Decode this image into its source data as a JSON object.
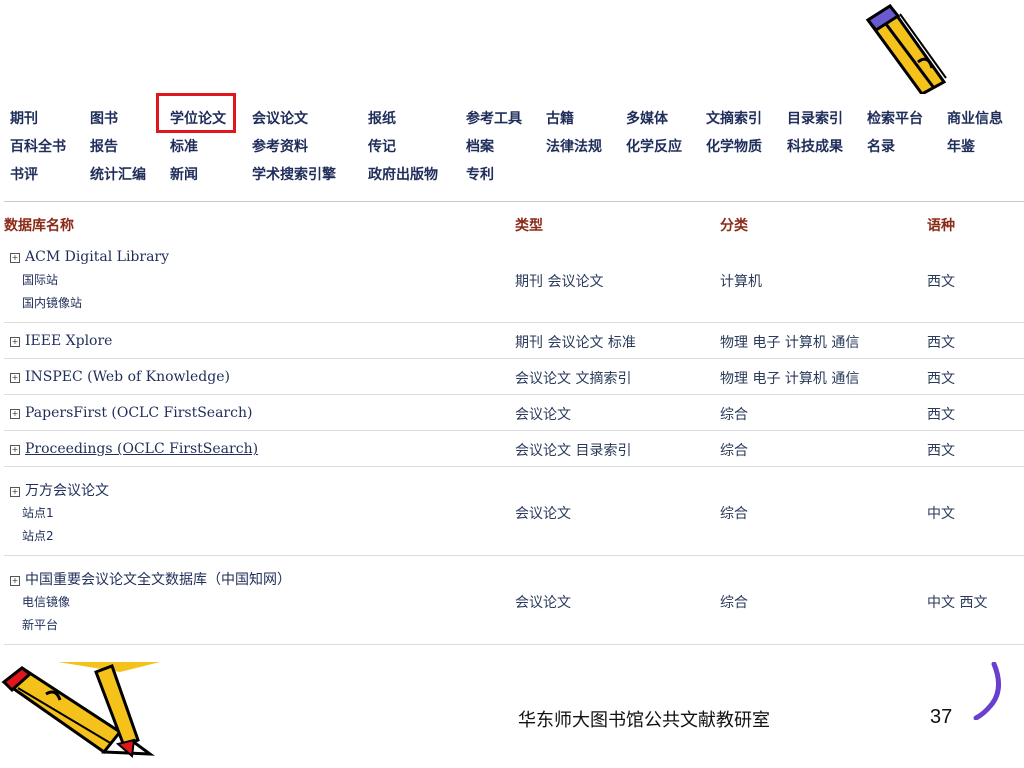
{
  "nav": {
    "row1": [
      "期刊",
      "图书",
      "学位论文",
      "会议论文",
      "报纸",
      "参考工具",
      "古籍",
      "多媒体",
      "文摘索引",
      "目录索引",
      "检索平台",
      "商业信息"
    ],
    "row2": [
      "百科全书",
      "报告",
      "标准",
      "参考资料",
      "传记",
      "档案",
      "法律法规",
      "化学反应",
      "化学物质",
      "科技成果",
      "名录",
      "年鉴"
    ],
    "row3": [
      "书评",
      "统计汇编",
      "新闻",
      "学术搜索引擎",
      "政府出版物",
      "专利"
    ],
    "highlighted": "学位论文",
    "highlight_color": "#e0161c"
  },
  "table": {
    "headers": {
      "name": "数据库名称",
      "type": "类型",
      "category": "分类",
      "language": "语种"
    },
    "rows": [
      {
        "name": "ACM Digital Library",
        "subs": [
          "国际站",
          "国内镜像站"
        ],
        "type": "期刊 会议论文",
        "category": "计算机",
        "language": "西文"
      },
      {
        "name": "IEEE Xplore",
        "subs": [],
        "type": "期刊 会议论文 标准",
        "category": "物理 电子 计算机 通信",
        "language": "西文"
      },
      {
        "name": "INSPEC (Web of Knowledge)",
        "subs": [],
        "type": "会议论文 文摘索引",
        "category": "物理 电子 计算机 通信",
        "language": "西文"
      },
      {
        "name": "PapersFirst (OCLC FirstSearch)",
        "subs": [],
        "type": "会议论文",
        "category": "综合",
        "language": "西文"
      },
      {
        "name": "Proceedings (OCLC FirstSearch)",
        "subs": [],
        "type": "会议论文 目录索引",
        "category": "综合",
        "language": "西文"
      },
      {
        "name": "万方会议论文",
        "subs": [
          "站点1",
          "站点2"
        ],
        "type": "会议论文",
        "category": "综合",
        "language": "中文"
      },
      {
        "name": "中国重要会议论文全文数据库（中国知网）",
        "subs": [
          "电信镜像",
          "新平台"
        ],
        "type": "会议论文",
        "category": "综合",
        "language": "中文 西文"
      }
    ]
  },
  "footer": {
    "text": "华东师大图书馆公共文献教研室",
    "page": "37"
  },
  "decor": {
    "pencil_icon_top": "pencil-icon",
    "pencil_icon_bottom": "pencil-icon"
  }
}
